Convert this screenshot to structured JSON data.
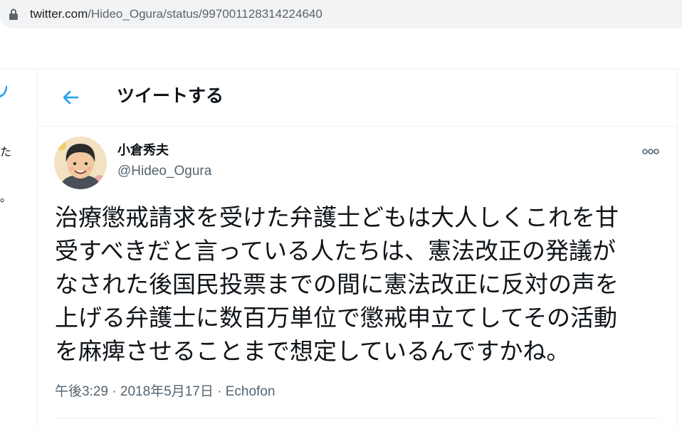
{
  "browser": {
    "url_host": "twitter.com",
    "url_path": "/Hideo_Ogura/status/997001128314224640"
  },
  "left_column": {
    "fragments": [
      "た",
      "。"
    ]
  },
  "header": {
    "title": "ツイートする"
  },
  "tweet": {
    "author_name": "小倉秀夫",
    "author_handle": "@Hideo_Ogura",
    "lines": [
      "治療懲戒請求を受けた弁護士どもは大人しくこれを甘",
      "受すべきだと言っている人たちは、憲法改正の発議が",
      "なされた後国民投票までの間に憲法改正に反対の声を",
      "上げる弁護士に数百万単位で懲戒申立てしてその活動",
      "を麻痺させることまで想定しているんですかね。"
    ],
    "time": "午後3:29",
    "date": "2018年5月17日",
    "separator": " · ",
    "source": "Echofon"
  },
  "colors": {
    "accent": "#1d9bf0",
    "secondary_text": "#536471",
    "border": "#eff3f4"
  },
  "icons": {
    "lock": "lock-icon",
    "back": "back-arrow-icon",
    "more": "more-options-icon",
    "bird": "twitter-bird-icon"
  }
}
